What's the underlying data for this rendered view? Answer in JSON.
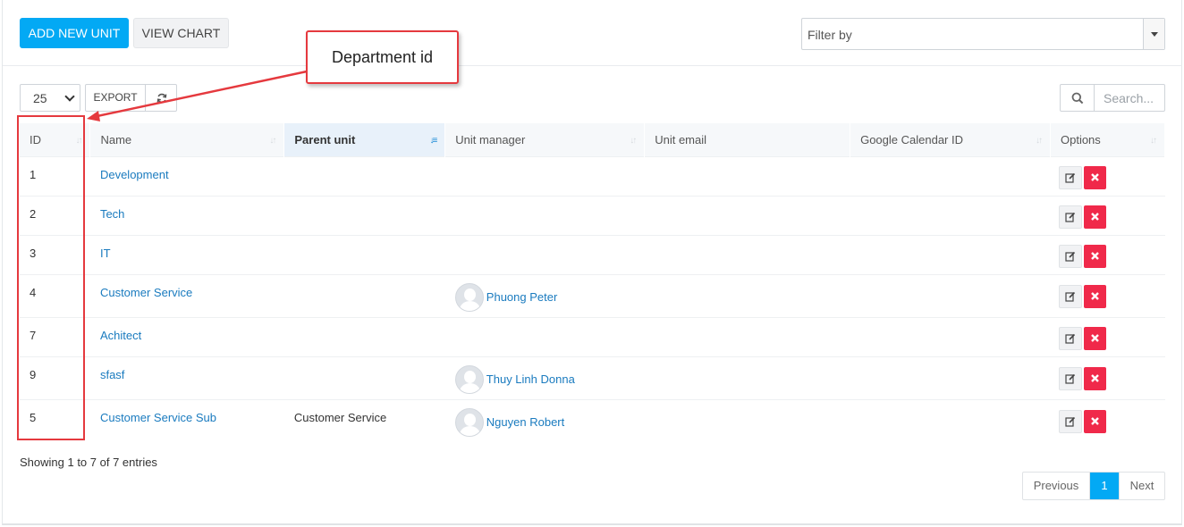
{
  "toolbar": {
    "add_label": "ADD NEW UNIT",
    "chart_label": "VIEW CHART",
    "filter_placeholder": "Filter by"
  },
  "table_controls": {
    "page_length": "25",
    "export_label": "EXPORT",
    "search_placeholder": "Search..."
  },
  "table": {
    "columns": [
      "ID",
      "Name",
      "Parent unit",
      "Unit manager",
      "Unit email",
      "Google Calendar ID",
      "Options"
    ],
    "sorted_column": "Parent unit",
    "rows": [
      {
        "id": "1",
        "name": "Development",
        "parent": "",
        "manager": "",
        "email": "",
        "gcal": ""
      },
      {
        "id": "2",
        "name": "Tech",
        "parent": "",
        "manager": "",
        "email": "",
        "gcal": ""
      },
      {
        "id": "3",
        "name": "IT",
        "parent": "",
        "manager": "",
        "email": "",
        "gcal": ""
      },
      {
        "id": "4",
        "name": "Customer Service",
        "parent": "",
        "manager": "Phuong Peter",
        "email": "",
        "gcal": ""
      },
      {
        "id": "7",
        "name": "Achitect",
        "parent": "",
        "manager": "",
        "email": "",
        "gcal": ""
      },
      {
        "id": "9",
        "name": "sfasf",
        "parent": "",
        "manager": "Thuy Linh Donna",
        "email": "",
        "gcal": ""
      },
      {
        "id": "5",
        "name": "Customer Service Sub",
        "parent": "Customer Service",
        "manager": "Nguyen Robert",
        "email": "",
        "gcal": ""
      }
    ]
  },
  "footer": {
    "info": "Showing 1 to 7 of 7 entries",
    "prev_label": "Previous",
    "current_page": "1",
    "next_label": "Next"
  },
  "annotation": {
    "callout_text": "Department id",
    "color": "#e5393e"
  },
  "colors": {
    "primary": "#03a9f4",
    "danger": "#f0294a",
    "link": "#1a7bbf"
  }
}
